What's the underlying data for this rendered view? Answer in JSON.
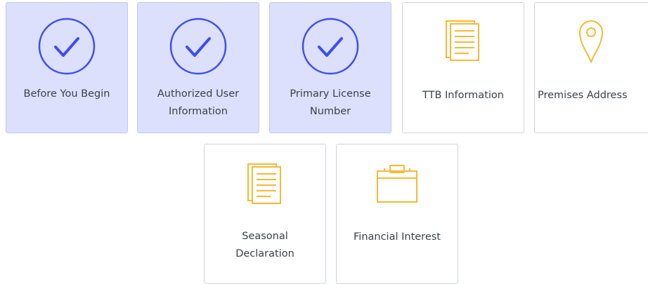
{
  "steps": [
    {
      "label": "Before You Begin",
      "status": "completed",
      "icon": "check-circle-icon"
    },
    {
      "label": "Authorized User Information",
      "status": "completed",
      "icon": "check-circle-icon"
    },
    {
      "label": "Primary License Number",
      "status": "completed",
      "icon": "check-circle-icon"
    },
    {
      "label": "TTB Information",
      "status": "pending",
      "icon": "document-icon"
    },
    {
      "label": "Premises Address",
      "status": "pending",
      "icon": "map-pin-icon"
    },
    {
      "label": "Seasonal Declaration",
      "status": "pending",
      "icon": "document-icon"
    },
    {
      "label": "Financial Interest",
      "status": "pending",
      "icon": "briefcase-icon"
    }
  ],
  "colors": {
    "completed_bg": "#dde0fc",
    "check_blue": "#3b4ef5",
    "pending_icon": "#f5b935"
  }
}
